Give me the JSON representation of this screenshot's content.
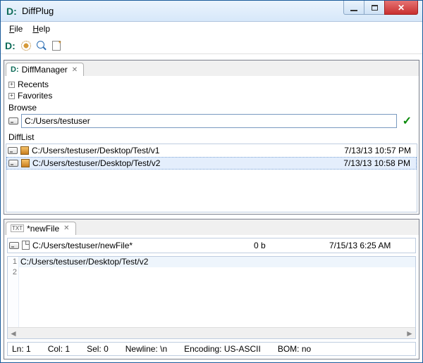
{
  "window": {
    "title": "DiffPlug"
  },
  "menu": {
    "file": "File",
    "help": "Help"
  },
  "diffmanager": {
    "tab_label": "DiffManager",
    "recents": "Recents",
    "favorites": "Favorites",
    "browse_label": "Browse",
    "browse_path": "C:/Users/testuser",
    "difflist_label": "DiffList",
    "rows": [
      {
        "path": "C:/Users/testuser/Desktop/Test/v1",
        "time": "7/13/13 10:57 PM"
      },
      {
        "path": "C:/Users/testuser/Desktop/Test/v2",
        "time": "7/13/13 10:58 PM"
      }
    ]
  },
  "editor": {
    "tab_label": "*newFile",
    "file_path": "C:/Users/testuser/newFile*",
    "file_size": "0 b",
    "file_time": "7/15/13 6:25 AM",
    "line1": "C:/Users/testuser/Desktop/Test/v2",
    "g1": "1",
    "g2": "2"
  },
  "status": {
    "ln": "Ln:  1",
    "col": "Col:  1",
    "sel": "Sel:  0",
    "newline": "Newline:  \\n",
    "encoding": "Encoding:  US-ASCII",
    "bom": "BOM:  no"
  }
}
